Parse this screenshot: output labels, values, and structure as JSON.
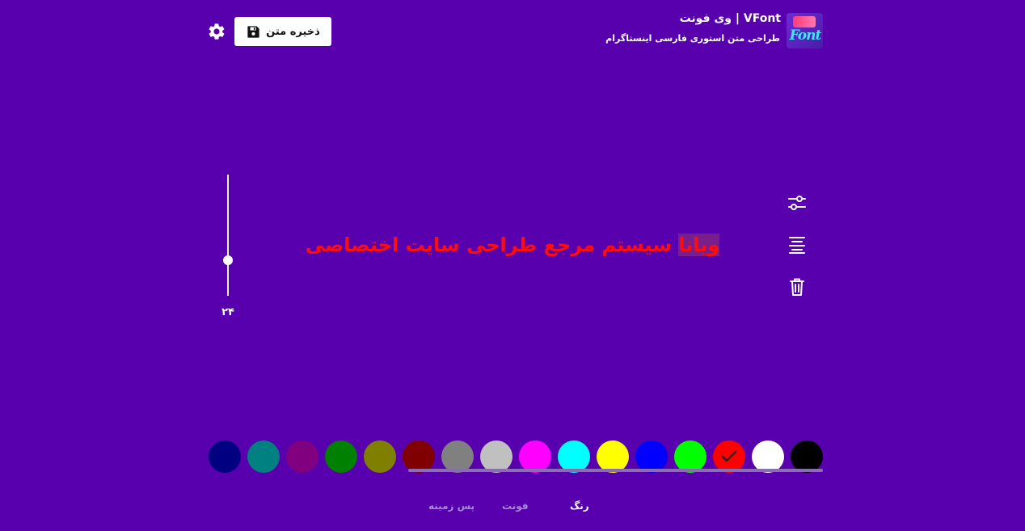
{
  "header": {
    "title": "وی فونت | VFont",
    "subtitle": "طراحی متن استوری فارسی اینستاگرام",
    "logo_text": "Font",
    "save_label": "ذخیره متن"
  },
  "editor": {
    "text_highlight": "ویانا",
    "text_rest": " سیستم مرجع طراحی سایت اختصاصی",
    "text_color": "#ff0d0d"
  },
  "tools": {
    "items": [
      "sliders-icon",
      "align-center-icon",
      "trash-icon"
    ]
  },
  "font_size": {
    "value": "۲۴"
  },
  "palette": {
    "selected": "#ff0000",
    "colors": [
      "#000000",
      "#ffffff",
      "#ff0000",
      "#00ff00",
      "#0000ff",
      "#ffff00",
      "#00ffff",
      "#ff00ff",
      "#c0c0c0",
      "#808080",
      "#800000",
      "#808000",
      "#008000",
      "#800080",
      "#008080",
      "#000080"
    ]
  },
  "tabs": {
    "color": "رنگ",
    "font": "فونت",
    "background": "پس زمینه",
    "active": "color"
  }
}
